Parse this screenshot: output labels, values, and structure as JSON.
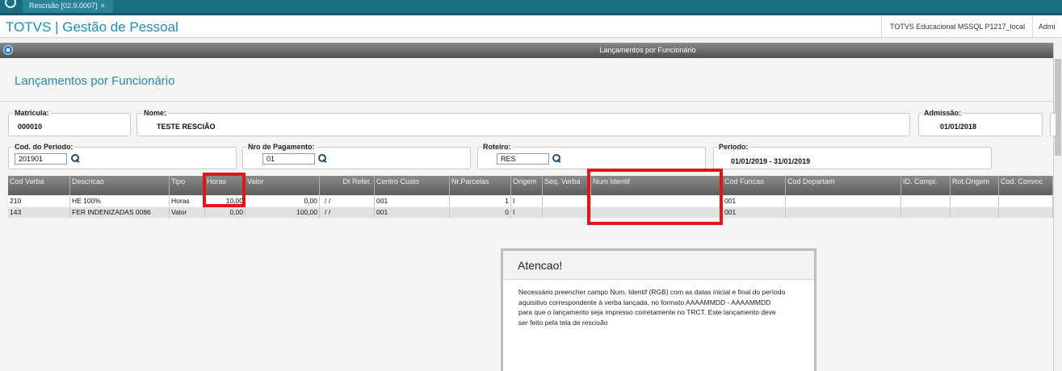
{
  "topbar": {
    "tab_label": "Rescisão [02.9.0007]",
    "close_glyph": "×"
  },
  "header": {
    "brand": "TOTVS | Gestão de Pessoal",
    "environment": "TOTVS Educacional MSSQL P1217_local",
    "user": "Admi"
  },
  "window": {
    "title": "Lançamentos por Funcionário"
  },
  "page": {
    "title": "Lançamentos por Funcionário"
  },
  "form": {
    "matricula": {
      "label": "Matricula:",
      "value": "000010"
    },
    "nome": {
      "label": "Nome:",
      "value": "TESTE RESCIÃO"
    },
    "admissao": {
      "label": "Admissão:",
      "value": "01/01/2018"
    },
    "cod_periodo": {
      "label": "Cod. do Periodo:",
      "value": "201901"
    },
    "nro_pagamento": {
      "label": "Nro de Pagamento:",
      "value": "01"
    },
    "roteiro": {
      "label": "Roteiro:",
      "value": "RES"
    },
    "periodo": {
      "label": "Periodo:",
      "value": "01/01/2019 - 31/01/2019"
    }
  },
  "grid": {
    "columns": [
      "Cod Verba",
      "Descricao",
      "Tipo",
      "Horas",
      "Valor",
      "Dt Refer.",
      "Centro Custo",
      "Nr.Parcelas",
      "Origem",
      "Seq. Verba",
      "Num Identif",
      "Cod Funcao",
      "Cod Departam",
      "ID. Compl.",
      "Rot.Origem",
      "Cod. Convoc"
    ],
    "rows": [
      [
        "210",
        "HE 100%",
        "Horas",
        "10,00",
        "0,00",
        "/ /",
        "001",
        "1",
        "I",
        "",
        "",
        "001",
        "",
        "",
        "",
        ""
      ],
      [
        "143",
        "FER INDENIZADAS 0086",
        "Valor",
        "0,00",
        "100,00",
        "/ /",
        "001",
        "0",
        "I",
        "",
        "",
        "001",
        "",
        "",
        "",
        ""
      ]
    ]
  },
  "dialog": {
    "title": "Atencao!",
    "message_lines": [
      "Necessário preencher campo Num. Identif (RGB) com as datas inicial e final do período",
      "aquisitivo correspondente à verba lançada, no formato AAAAMMDD - AAAAMMDD",
      "para que o lançamento seja impresso corretamente no TRCT. Este lançamento deve",
      "ser feito pela tela de rescisão"
    ]
  },
  "colors": {
    "accent": "#1c8fb1",
    "topbar": "#1a6e80",
    "highlight": "#e0161c"
  }
}
